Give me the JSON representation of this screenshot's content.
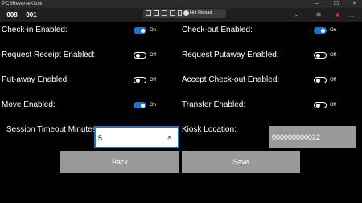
{
  "window": {
    "title": "PCSReverseKiosk",
    "buttons": {
      "minimize": "–",
      "maximize": "☐",
      "close": "✕"
    }
  },
  "header": {
    "counter_left": "008",
    "counter_right": "001"
  },
  "debug_toolbar": {
    "reload_label": "Hot Reload"
  },
  "settings": {
    "checkin": {
      "label": "Check-in Enabled:",
      "state": "On",
      "on": true
    },
    "checkout": {
      "label": "Check-out Enabled:",
      "state": "On",
      "on": true
    },
    "request_receipt": {
      "label": "Request Receipt Enabled:",
      "state": "Off",
      "on": false
    },
    "request_putaway": {
      "label": "Request Putaway Enabled:",
      "state": "Off",
      "on": false
    },
    "putaway": {
      "label": "Put-away Enabled:",
      "state": "Off",
      "on": false
    },
    "accept_checkout": {
      "label": "Accept Check-out Enabled:",
      "state": "Off",
      "on": false
    },
    "move": {
      "label": "Move Enabled:",
      "state": "On",
      "on": true
    },
    "transfer": {
      "label": "Transfer Enabled:",
      "state": "Off",
      "on": false
    }
  },
  "session_timeout": {
    "label": "Session Timeout Minutes:",
    "value": "5"
  },
  "kiosk_location": {
    "label": "Kiosk Location:",
    "value": "000000000022"
  },
  "actions": {
    "back_label": "Back",
    "save_label": "Save"
  },
  "colors": {
    "background": "#000000",
    "accent": "#1a75d2",
    "button": "#999999"
  }
}
